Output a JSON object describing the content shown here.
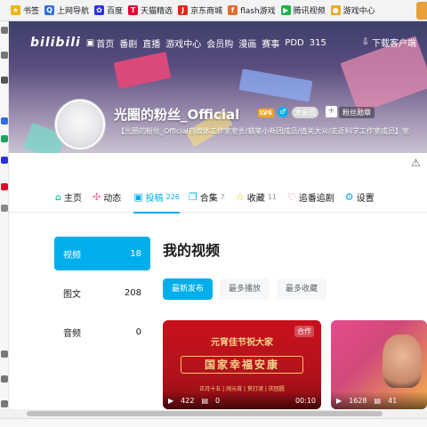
{
  "bookmarks": [
    {
      "label": "书签",
      "icon": "star-icon",
      "color": "#f4b400"
    },
    {
      "label": "上网导航",
      "icon": "q-logo-icon",
      "color": "#2f6fe4"
    },
    {
      "label": "百度",
      "icon": "baidu-paw-icon",
      "color": "#2932e1"
    },
    {
      "label": "天猫精选",
      "icon": "tmall-icon",
      "color": "#e4002b"
    },
    {
      "label": "京东商城",
      "icon": "jd-icon",
      "color": "#e1251b"
    },
    {
      "label": "flash游戏",
      "icon": "flash-icon",
      "color": "#e36b2c"
    },
    {
      "label": "腾讯视频",
      "icon": "tencent-video-icon",
      "color": "#20b04b"
    },
    {
      "label": "游戏中心",
      "icon": "gamepad-icon",
      "color": "#f5a623"
    }
  ],
  "nav": {
    "logo": "bilibili",
    "items": [
      "首页",
      "番剧",
      "直播",
      "游戏中心",
      "会员购",
      "漫画",
      "赛事",
      "PDD",
      "315"
    ],
    "download": "下载客户端"
  },
  "profile": {
    "name": "光圈的粉丝_Official",
    "level": "LV6",
    "gender": "♂",
    "vip": "大会员",
    "plus": "+",
    "fan_badge": "粉丝勋章",
    "sign": "【光圈的粉丝_Official自媒体工作室室长/蜡笔小新团成员/值关大众/走近科学工作室成员】室"
  },
  "tabs": [
    {
      "label": "主页",
      "count": "",
      "icon": "home-icon"
    },
    {
      "label": "动态",
      "count": "",
      "icon": "dynamic-icon"
    },
    {
      "label": "投稿",
      "count": "226",
      "icon": "upload-tv-icon",
      "active": true
    },
    {
      "label": "合集",
      "count": "7",
      "icon": "collection-icon"
    },
    {
      "label": "收藏",
      "count": "11",
      "icon": "favorite-star-icon"
    },
    {
      "label": "追番追剧",
      "count": "",
      "icon": "heart-icon"
    },
    {
      "label": "设置",
      "count": "",
      "icon": "settings-icon"
    }
  ],
  "sidebar": [
    {
      "label": "视频",
      "count": "18",
      "active": true
    },
    {
      "label": "图文",
      "count": "208"
    },
    {
      "label": "音频",
      "count": "0"
    }
  ],
  "section_title": "我的视频",
  "filters": [
    {
      "label": "最新发布",
      "active": true
    },
    {
      "label": "最多播放"
    },
    {
      "label": "最多收藏"
    }
  ],
  "videos": [
    {
      "title": "元宵佳节祝大家",
      "main": "国家幸福安康",
      "sub": "正月十五 | 闹元宵 | 赏灯谜 | 庆团圆",
      "tag": "合作",
      "plays": "422",
      "comments": "0",
      "duration": "00:10"
    },
    {
      "plays": "1628",
      "comments": "41"
    }
  ],
  "colors": {
    "accent": "#00aeec",
    "text": "#18191c",
    "muted": "#9499a0"
  }
}
